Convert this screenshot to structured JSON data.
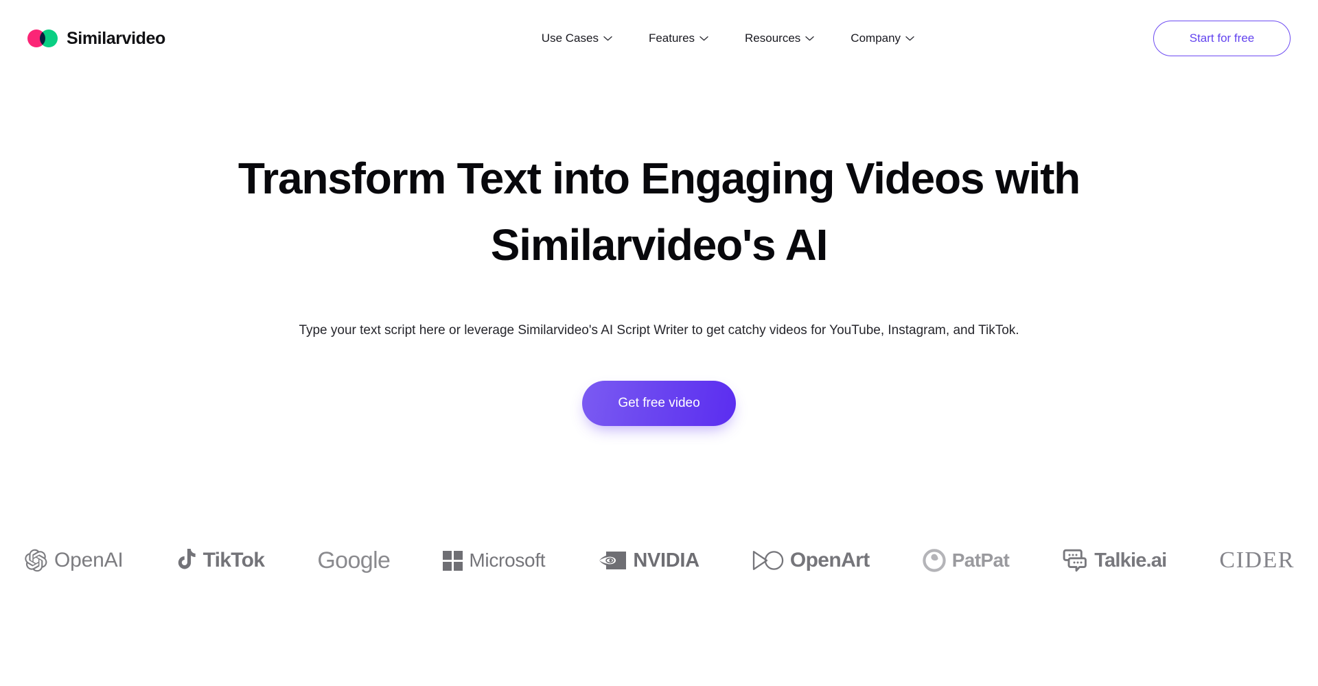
{
  "brand": {
    "name": "Similarvideo",
    "mark_colors": {
      "left": "#FB2576",
      "right": "#0ACF83",
      "overlap": "#6C4AF2"
    }
  },
  "header": {
    "nav_items": [
      {
        "label": "Use Cases",
        "icon": "chevron-down-icon"
      },
      {
        "label": "Features",
        "icon": "chevron-down-icon"
      },
      {
        "label": "Resources",
        "icon": "chevron-down-icon"
      },
      {
        "label": "Company",
        "icon": "chevron-down-icon"
      }
    ],
    "cta": {
      "label": "Start for free",
      "color": "#6243EF",
      "border_color": "#6C4AF2"
    }
  },
  "hero": {
    "title": "Transform Text into Engaging Videos with Similarvideo's AI",
    "subtitle": "Type your text script here or leverage Similarvideo's AI Script Writer to get catchy videos for YouTube, Instagram, and TikTok.",
    "cta": {
      "label": "Get free video",
      "gradient_from": "#7B5BF2",
      "gradient_to": "#5B2DF0"
    }
  },
  "logos": {
    "items": [
      {
        "name": "OpenAI",
        "icon": "openai-icon"
      },
      {
        "name": "TikTok",
        "icon": "tiktok-icon"
      },
      {
        "name": "Google",
        "icon": "none"
      },
      {
        "name": "Microsoft",
        "icon": "microsoft-icon"
      },
      {
        "name": "NVIDIA",
        "icon": "nvidia-icon"
      },
      {
        "name": "OpenArt",
        "icon": "openart-icon"
      },
      {
        "name": "PatPat",
        "icon": "patpat-icon"
      },
      {
        "name": "Talkie.ai",
        "icon": "talkie-icon"
      },
      {
        "name": "CIDER",
        "icon": "none"
      }
    ],
    "color": "#7e7e82"
  }
}
